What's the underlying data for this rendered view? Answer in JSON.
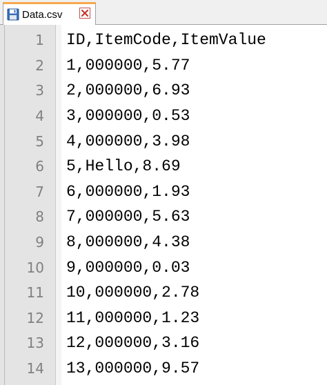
{
  "tab": {
    "title": "Data.csv",
    "icon": "floppy-disk-icon",
    "close_icon": "close-icon",
    "accent_color": "#f7a84c"
  },
  "editor": {
    "lines": [
      {
        "number": "1",
        "text": "ID,ItemCode,ItemValue"
      },
      {
        "number": "2",
        "text": "1,000000,5.77"
      },
      {
        "number": "3",
        "text": "2,000000,6.93"
      },
      {
        "number": "4",
        "text": "3,000000,0.53"
      },
      {
        "number": "5",
        "text": "4,000000,3.98"
      },
      {
        "number": "6",
        "text": "5,Hello,8.69"
      },
      {
        "number": "7",
        "text": "6,000000,1.93"
      },
      {
        "number": "8",
        "text": "7,000000,5.63"
      },
      {
        "number": "9",
        "text": "8,000000,4.38"
      },
      {
        "number": "10",
        "text": "9,000000,0.03"
      },
      {
        "number": "11",
        "text": "10,000000,2.78"
      },
      {
        "number": "12",
        "text": "11,000000,1.23"
      },
      {
        "number": "13",
        "text": "12,000000,3.16"
      },
      {
        "number": "14",
        "text": "13,000000,9.57"
      }
    ]
  }
}
